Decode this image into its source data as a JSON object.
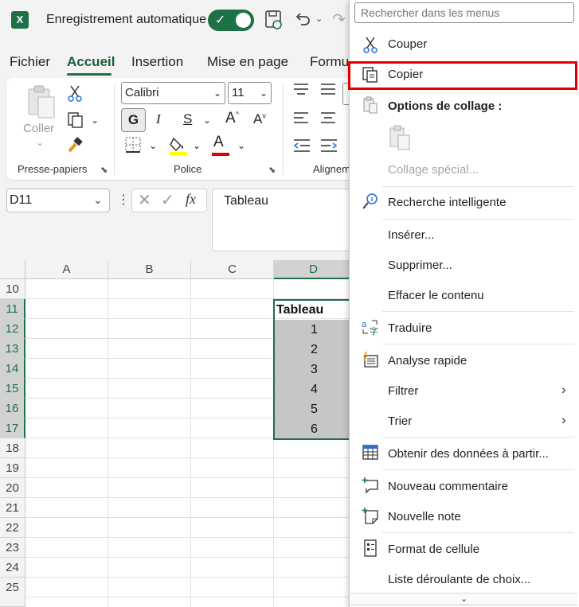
{
  "titlebar": {
    "autosave_label": "Enregistrement automatique",
    "autosave_on": true,
    "logo_letter": "X"
  },
  "tabs": [
    {
      "label": "Fichier",
      "active": false
    },
    {
      "label": "Accueil",
      "active": true
    },
    {
      "label": "Insertion",
      "active": false
    },
    {
      "label": "Mise en page",
      "active": false
    },
    {
      "label": "Formu",
      "active": false
    }
  ],
  "ribbon": {
    "clipboard": {
      "paste_label": "Coller",
      "group_label": "Presse-papiers"
    },
    "font": {
      "name": "Calibri",
      "size": "11",
      "bold": "G",
      "italic": "I",
      "underline": "S",
      "grow": "A",
      "shrink": "A",
      "font_color_letter": "A",
      "group_label": "Police"
    },
    "align": {
      "group_label": "Alignem"
    }
  },
  "formula_bar": {
    "name_box": "D11",
    "formula": "Tableau",
    "fx": "fx"
  },
  "grid": {
    "columns": [
      "A",
      "B",
      "C",
      "D"
    ],
    "selected_column": "D",
    "rows": [
      "10",
      "11",
      "12",
      "13",
      "14",
      "15",
      "16",
      "17",
      "18",
      "19",
      "20",
      "21",
      "22",
      "23",
      "24",
      "25"
    ],
    "selected_rows": [
      "11",
      "12",
      "13",
      "14",
      "15",
      "16",
      "17"
    ],
    "cells": {
      "D11": "Tableau",
      "D12": "1",
      "D13": "2",
      "D14": "3",
      "D15": "4",
      "D16": "5",
      "D17": "6"
    }
  },
  "context_menu": {
    "search_placeholder": "Rechercher dans les menus",
    "items": {
      "couper": "Couper",
      "copier": "Copier",
      "options_collage": "Options de collage :",
      "collage_special": "Collage spécial...",
      "recherche": "Recherche intelligente",
      "inserer": "Insérer...",
      "supprimer": "Supprimer...",
      "effacer": "Effacer le contenu",
      "traduire": "Traduire",
      "analyse": "Analyse rapide",
      "filtrer": "Filtrer",
      "trier": "Trier",
      "obtenir": "Obtenir des données à partir...",
      "nouveau_commentaire": "Nouveau commentaire",
      "nouvelle_note": "Nouvelle note",
      "format_cellule": "Format de cellule",
      "liste": "Liste déroulante de choix..."
    },
    "highlighted_item": "Copier",
    "highlight_color": "#e00000"
  },
  "colors": {
    "accent": "#1e7145"
  }
}
